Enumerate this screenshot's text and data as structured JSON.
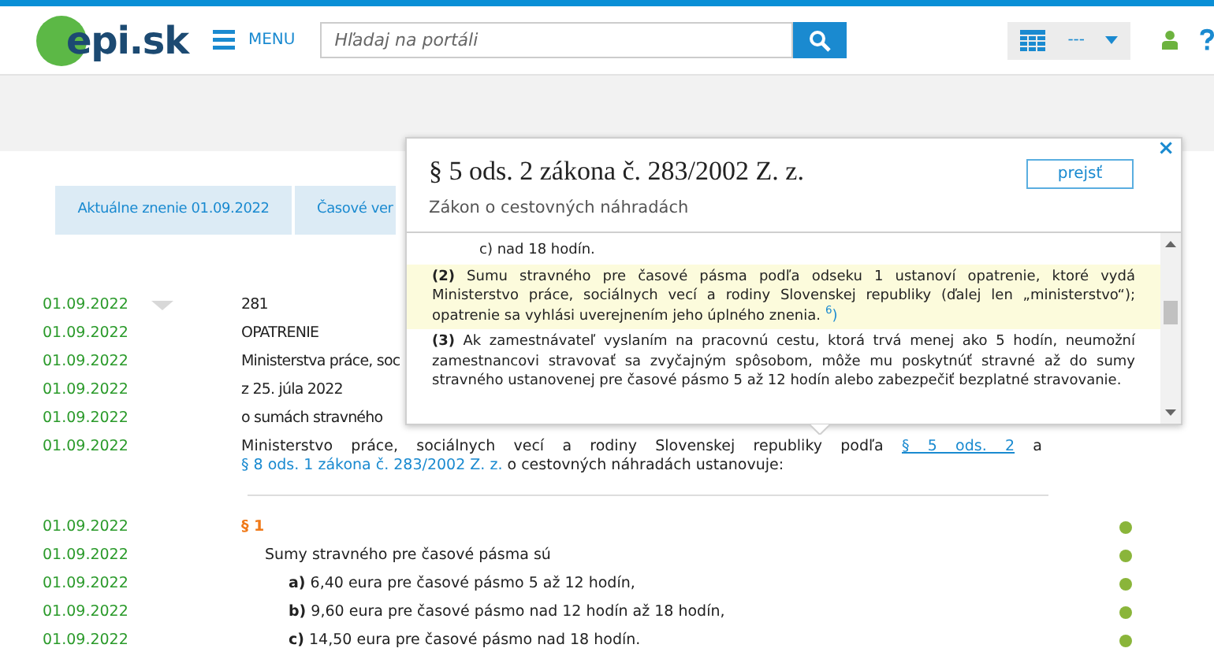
{
  "header": {
    "logo": "epi.sk",
    "menu": "MENU",
    "search": {
      "placeholder": "Hľadaj na portáli"
    },
    "view_select": "---"
  },
  "tabs": [
    {
      "label": "Aktuálne znenie 01.09.2022"
    },
    {
      "label": "Časové ver"
    }
  ],
  "rows": [
    {
      "kind": "text",
      "date": "01.09.2022",
      "text": "281",
      "marked": false
    },
    {
      "kind": "text",
      "date": "01.09.2022",
      "text": "OPATRENIE",
      "marked": false
    },
    {
      "kind": "text",
      "date": "01.09.2022",
      "text": "Ministerstva práce, soc",
      "marked": false
    },
    {
      "kind": "text",
      "date": "01.09.2022",
      "text": "z 25. júla 2022",
      "marked": false
    },
    {
      "kind": "text",
      "date": "01.09.2022",
      "text": "o sumách stravného",
      "marked": false
    },
    {
      "kind": "links",
      "date": "01.09.2022",
      "parts": [
        {
          "text": "Ministerstvo práce, sociálnych vecí a rodiny Slovenskej republiky podľa ",
          "link": false,
          "underlined": false
        },
        {
          "text": "§ 5 ods. 2",
          "link": true,
          "underlined": true
        },
        {
          "text": " a ",
          "link": false,
          "underlined": false
        },
        {
          "text": "§ 8 ods. 1 zákona č. 283/2002 Z. z.",
          "link": true,
          "underlined": false
        },
        {
          "text": " o cestovných náhradách ustanovuje:",
          "link": false,
          "underlined": false
        }
      ],
      "marked": false
    },
    {
      "kind": "divider"
    },
    {
      "kind": "section",
      "date": "01.09.2022",
      "text": "§ 1",
      "marked": true
    },
    {
      "kind": "paragraph",
      "date": "01.09.2022",
      "text": "Sumy stravného pre časové pásma sú",
      "marked": true
    },
    {
      "kind": "item",
      "date": "01.09.2022",
      "label": "a)",
      "text": "6,40 eura pre časové pásmo 5 až 12 hodín,",
      "marked": true
    },
    {
      "kind": "item",
      "date": "01.09.2022",
      "label": "b)",
      "text": "9,60 eura pre časové pásmo nad 12 hodín až 18 hodín,",
      "marked": true
    },
    {
      "kind": "item",
      "date": "01.09.2022",
      "label": "c)",
      "text": "14,50 eura pre časové pásmo nad 18 hodín.",
      "marked": true
    }
  ],
  "popup": {
    "title": "§ 5 ods. 2 zákona č. 283/2002 Z. z.",
    "subtitle": "Zákon o cestovných náhradách",
    "button": "prejsť",
    "close": "×",
    "content": [
      {
        "kind": "item",
        "label": "c)",
        "text": "nad 18 hodín.",
        "highlighted": false
      },
      {
        "kind": "paragraph",
        "number": "(2)",
        "text": "Sumu stravného pre časové pásma podľa odseku 1 ustanoví opatrenie, ktoré vydá Ministerstvo práce, sociálnych vecí a rodiny Slovenskej republiky (ďalej len „ministerstvo“); opatrenie sa vyhlási uverejnením jeho úplného znenia.",
        "footnote": "$^{6}$)",
        "highlighted": true
      },
      {
        "kind": "paragraph",
        "number": "(3)",
        "text": "Ak zamestnávateľ vyslaním na pracovnú cestu, ktorá trvá menej ako 5 hodín, neumožní zamestnancovi stravovať sa zvyčajným spôsobom, môže mu poskytnúť stravné až do sumy stravného ustanovenej pre časové pásmo 5 až 12 hodín alebo zabezpečiť bezplatné stravovanie.",
        "highlighted": false
      }
    ]
  }
}
